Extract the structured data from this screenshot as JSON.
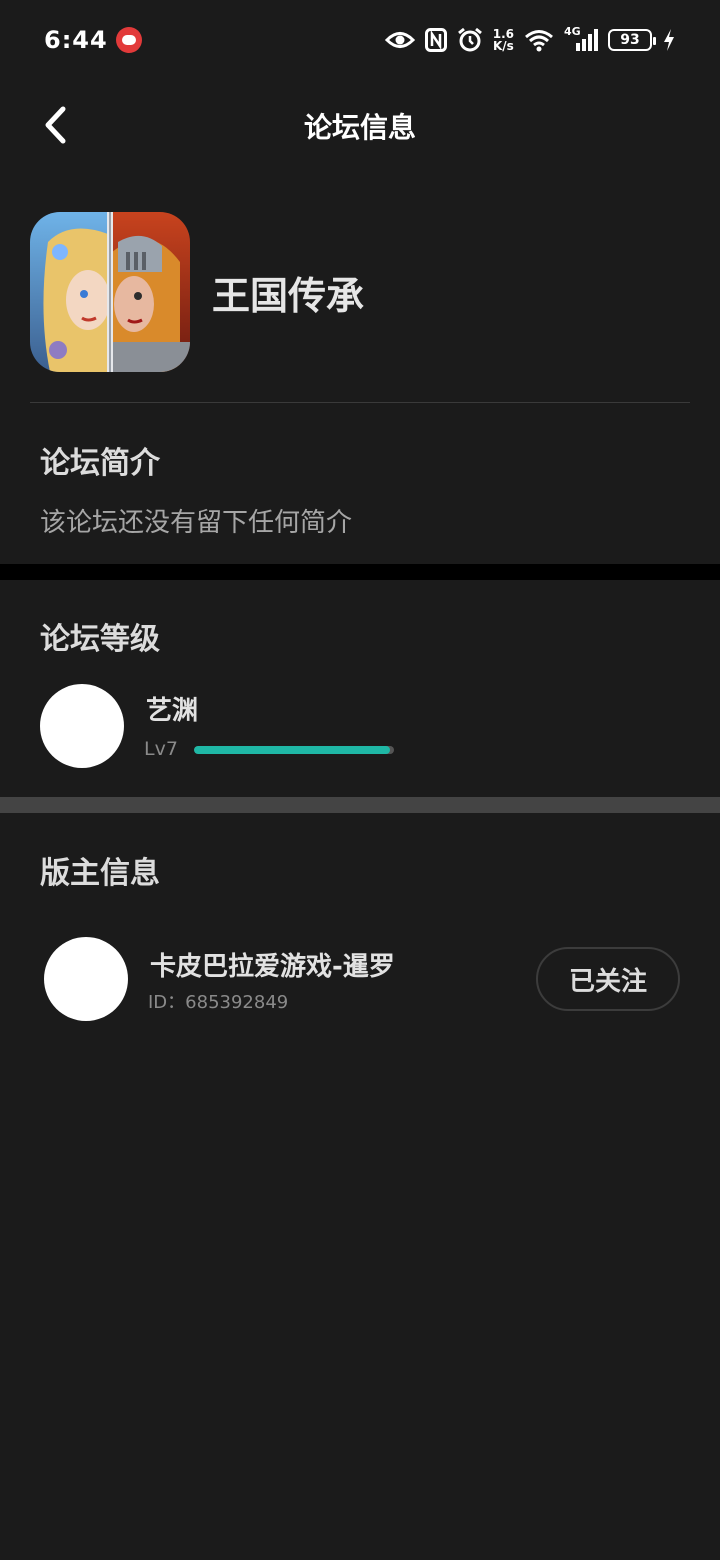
{
  "status_bar": {
    "time": "6:44",
    "speed_top": "1.6",
    "speed_bottom": "K/s",
    "network": "4G",
    "battery": "93"
  },
  "header": {
    "title": "论坛信息",
    "back_icon": "chevron-left-icon"
  },
  "forum": {
    "name": "王国传承"
  },
  "intro": {
    "title": "论坛简介",
    "text": "该论坛还没有留下任何简介"
  },
  "level": {
    "title": "论坛等级",
    "user_name": "艺渊",
    "level_label": "Lv7",
    "progress": 0.98,
    "progress_color": "#1fb8a6"
  },
  "moderator": {
    "title": "版主信息",
    "name": "卡皮巴拉爱游戏-暹罗",
    "id_text": "ID：685392849",
    "follow_label": "已关注"
  }
}
